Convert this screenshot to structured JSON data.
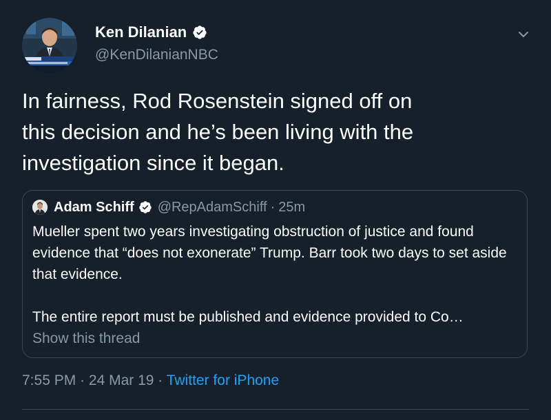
{
  "author": {
    "name": "Ken Dilanian",
    "handle": "@KenDilanianNBC",
    "verified": true
  },
  "tweet": {
    "text": "In fairness, Rod Rosenstein signed off on\nthis decision and he’s been living with the\ninvestigation since it began."
  },
  "quote": {
    "name": "Adam Schiff",
    "handle": "@RepAdamSchiff",
    "separator": "·",
    "time": "25m",
    "verified": true,
    "paragraph1": "Mueller spent two years investigating obstruction of justice and found evidence that “does not exonerate” Trump. Barr took two days to set aside that evidence.",
    "paragraph2": "The entire report must be published and evidence provided to Co…",
    "show_thread": "Show this thread"
  },
  "meta": {
    "time": "7:55 PM",
    "separator1": " · ",
    "date": "24 Mar 19",
    "separator2": " · ",
    "source": "Twitter for iPhone"
  },
  "colors": {
    "background": "#15202b",
    "text": "#ffffff",
    "secondary": "#8899a6",
    "accent": "#1da1f2",
    "border": "#38444d"
  },
  "icons": {
    "verified": "verified-badge-icon",
    "menu": "chevron-down-icon"
  }
}
